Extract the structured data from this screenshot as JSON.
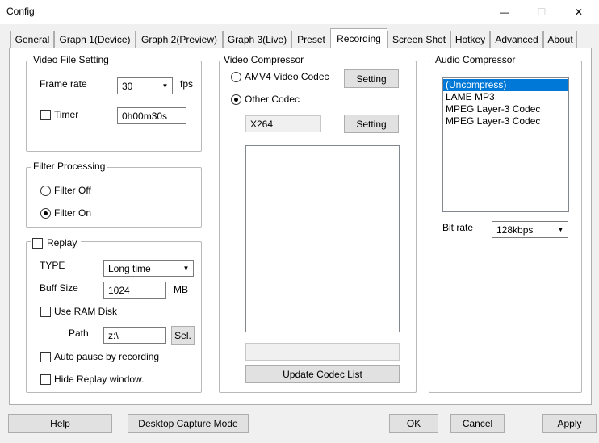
{
  "window": {
    "title": "Config",
    "minimize": "—",
    "maximize": "☐",
    "close": "✕"
  },
  "tabs": [
    {
      "label": "General"
    },
    {
      "label": "Graph 1(Device)"
    },
    {
      "label": "Graph 2(Preview)"
    },
    {
      "label": "Graph 3(Live)"
    },
    {
      "label": "Preset"
    },
    {
      "label": "Recording"
    },
    {
      "label": "Screen Shot"
    },
    {
      "label": "Hotkey"
    },
    {
      "label": "Advanced"
    },
    {
      "label": "About"
    }
  ],
  "active_tab": "Recording",
  "video_file_setting": {
    "legend": "Video File Setting",
    "frame_rate_label": "Frame rate",
    "frame_rate_value": "30",
    "fps_label": "fps",
    "timer_label": "Timer",
    "timer_checked": false,
    "timer_value": "0h00m30s"
  },
  "filter_processing": {
    "legend": "Filter Processing",
    "filter_off_label": "Filter Off",
    "filter_on_label": "Filter On",
    "selected": "Filter On"
  },
  "replay": {
    "legend": "Replay",
    "checked": false,
    "type_label": "TYPE",
    "type_value": "Long time",
    "buff_size_label": "Buff Size",
    "buff_size_value": "1024",
    "buff_unit": "MB",
    "use_ram_disk_label": "Use RAM Disk",
    "path_label": "Path",
    "path_value": "z:\\",
    "sel_button": "Sel.",
    "auto_pause_label": "Auto pause by recording",
    "hide_replay_label": "Hide Replay window."
  },
  "video_compressor": {
    "legend": "Video Compressor",
    "amv4_label": "AMV4 Video Codec",
    "other_codec_label": "Other Codec",
    "selected": "Other Codec",
    "setting_button_1": "Setting",
    "setting_button_2": "Setting",
    "codec_value": "X264",
    "update_button": "Update Codec List"
  },
  "audio_compressor": {
    "legend": "Audio Compressor",
    "items": [
      "(Uncompress)",
      "LAME MP3",
      "MPEG Layer-3 Codec",
      "MPEG Layer-3 Codec"
    ],
    "selected_index": 0,
    "bit_rate_label": "Bit rate",
    "bit_rate_value": "128kbps"
  },
  "footer": {
    "help": "Help",
    "desktop_capture": "Desktop Capture Mode",
    "ok": "OK",
    "cancel": "Cancel",
    "apply": "Apply"
  }
}
